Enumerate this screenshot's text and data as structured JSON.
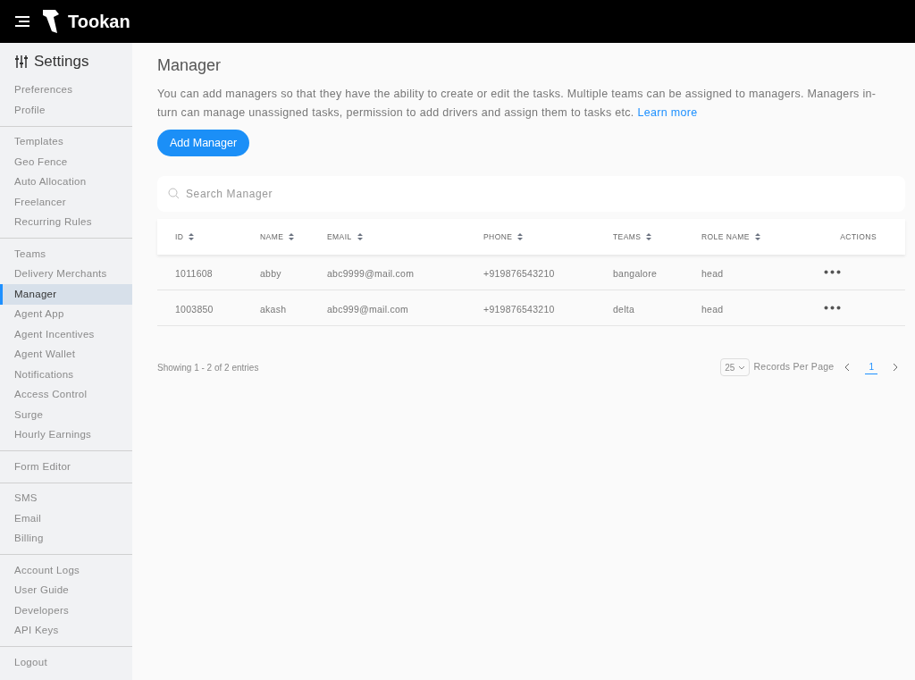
{
  "header": {
    "brand": "Tookan"
  },
  "sidebar": {
    "title": "Settings",
    "groups": [
      [
        {
          "label": "Preferences",
          "selected": false
        },
        {
          "label": "Profile",
          "selected": false
        }
      ],
      [
        {
          "label": "Templates",
          "selected": false
        },
        {
          "label": "Geo Fence",
          "selected": false
        },
        {
          "label": "Auto Allocation",
          "selected": false
        },
        {
          "label": "Freelancer",
          "selected": false
        },
        {
          "label": "Recurring Rules",
          "selected": false
        }
      ],
      [
        {
          "label": "Teams",
          "selected": false
        },
        {
          "label": "Delivery Merchants",
          "selected": false
        },
        {
          "label": "Manager",
          "selected": true
        },
        {
          "label": "Agent App",
          "selected": false
        },
        {
          "label": "Agent Incentives",
          "selected": false
        },
        {
          "label": "Agent Wallet",
          "selected": false
        },
        {
          "label": "Notifications",
          "selected": false
        },
        {
          "label": "Access Control",
          "selected": false
        },
        {
          "label": "Surge",
          "selected": false
        },
        {
          "label": "Hourly Earnings",
          "selected": false
        }
      ],
      [
        {
          "label": "Form Editor",
          "selected": false
        }
      ],
      [
        {
          "label": "SMS",
          "selected": false
        },
        {
          "label": "Email",
          "selected": false
        },
        {
          "label": "Billing",
          "selected": false
        }
      ],
      [
        {
          "label": "Account Logs",
          "selected": false
        },
        {
          "label": "User Guide",
          "selected": false
        },
        {
          "label": "Developers",
          "selected": false
        },
        {
          "label": "API Keys",
          "selected": false
        }
      ],
      [
        {
          "label": "Logout",
          "selected": false
        }
      ]
    ]
  },
  "page": {
    "title": "Manager",
    "description": "You can add managers so that they have the ability to create or edit the tasks. Multiple teams can be assigned to managers. Managers in-turn can manage unassigned tasks, permission to add drivers and assign them to tasks etc.",
    "learn_more": "Learn more",
    "add_button": "Add Manager"
  },
  "search": {
    "placeholder": "Search Manager"
  },
  "table": {
    "columns": [
      {
        "label": "ID",
        "sortable": true
      },
      {
        "label": "NAME",
        "sortable": true
      },
      {
        "label": "EMAIL",
        "sortable": true
      },
      {
        "label": "PHONE",
        "sortable": true
      },
      {
        "label": "TEAMS",
        "sortable": true
      },
      {
        "label": "ROLE NAME",
        "sortable": true
      },
      {
        "label": "ACTIONS",
        "sortable": false
      }
    ],
    "rows": [
      [
        "1011608",
        "abby",
        "abc9999@mail.com",
        "+919876543210",
        "bangalore",
        "head"
      ],
      [
        "1003850",
        "akash",
        "abc999@mail.com",
        "+919876543210",
        "delta",
        "head"
      ]
    ]
  },
  "footer": {
    "showing": "Showing 1 - 2 of 2 entries",
    "per_page": "25",
    "per_page_label": "Records Per Page",
    "pages": [
      {
        "label": "1",
        "selected": true
      }
    ]
  }
}
